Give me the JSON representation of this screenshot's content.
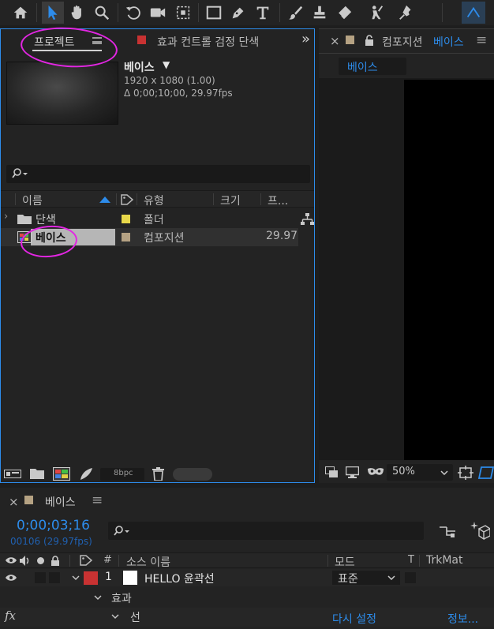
{
  "toolbar": {
    "icons": [
      "home-icon",
      "selection-tool-icon",
      "hand-tool-icon",
      "zoom-tool-icon",
      "rotate-tool-icon",
      "camera-tool-icon",
      "pan-behind-tool-icon",
      "rectangle-tool-icon",
      "pen-tool-icon",
      "type-tool-icon",
      "brush-tool-icon",
      "clone-stamp-tool-icon",
      "eraser-tool-icon",
      "roto-brush-tool-icon",
      "puppet-pin-tool-icon"
    ]
  },
  "project_panel": {
    "tab_project": "프로젝트",
    "tab_effects": "효과 컨트롤 검정 단색",
    "overflow": "»",
    "preview": {
      "name": "베이스",
      "arrow": "▼",
      "resolution": "1920 x 1080 (1.00)",
      "duration": "Δ 0;00;10;00, 29.97fps"
    },
    "columns": {
      "name": "이름",
      "type": "유형",
      "size": "크기",
      "frame": "프..."
    },
    "items": [
      {
        "name": "단색",
        "type": "폴더",
        "fps": "",
        "color": "#e8d84a"
      },
      {
        "name": "베이스",
        "type": "컴포지션",
        "fps": "29.97",
        "color": "#b5a283"
      }
    ],
    "bit_depth": "8bpc"
  },
  "comp_panel": {
    "close": "×",
    "title_prefix": "컴포지션",
    "title_name": "베이스",
    "menu": "≡",
    "breadcrumb": "베이스",
    "zoom": "50%"
  },
  "timeline": {
    "close": "×",
    "tab_name": "베이스",
    "timecode": "0;00;03;16",
    "frames": "00106 (29.97fps)",
    "columns": {
      "num": "#",
      "source": "소스 이름",
      "mode": "모드",
      "t": "T",
      "trkmat": "TrkMat"
    },
    "layer": {
      "index": "1",
      "name": "HELLO 윤곽선",
      "mode": "표준"
    },
    "effects_label": "효과",
    "stroke_label": "선",
    "fx": "fx",
    "reset": "다시 설정",
    "info": "정보..."
  },
  "colors": {
    "accent": "#2d8ceb",
    "annotation": "#e326e3",
    "comp_label": "#b5a283",
    "solid_label": "#c83232"
  }
}
